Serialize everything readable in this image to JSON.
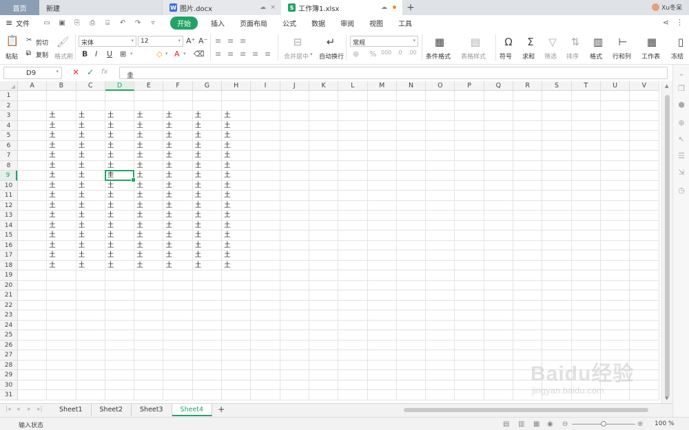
{
  "tabs": {
    "home": "首页",
    "new": "新建",
    "doc": "图片.docx",
    "xlsx": "工作簿1.xlsx",
    "add": "+"
  },
  "user": {
    "name": "Xu冬呆"
  },
  "menu": {
    "file": "文件",
    "items": [
      "开始",
      "插入",
      "页面布局",
      "公式",
      "数据",
      "审阅",
      "视图",
      "工具"
    ]
  },
  "ribbon": {
    "paste": "粘贴",
    "cut": "剪切",
    "copy": "复制",
    "format_painter": "格式刷",
    "font_name": "宋体",
    "font_size": "12",
    "bold": "B",
    "italic": "I",
    "underline": "U",
    "merge": "合并居中",
    "wrap": "自动换行",
    "number_format": "常规",
    "cond_format": "条件格式",
    "table_style": "表格样式",
    "symbol": "符号",
    "sum": "求和",
    "filter": "筛选",
    "sort": "排序",
    "format": "格式",
    "rowcol": "行和列",
    "worksheet": "工作表",
    "freeze": "冻结"
  },
  "formula_bar": {
    "cell_ref": "D9",
    "fx": "fx",
    "content": "圭"
  },
  "grid": {
    "columns": [
      "A",
      "B",
      "C",
      "D",
      "E",
      "F",
      "G",
      "H",
      "I",
      "J",
      "K",
      "L",
      "M",
      "N",
      "O",
      "P",
      "Q",
      "R",
      "S",
      "T",
      "U",
      "V"
    ],
    "rows": 31,
    "active_col": "D",
    "active_row": 9,
    "fill_char": "土",
    "active_char": "圭",
    "filled_rows_from": 3,
    "filled_rows_to": 18,
    "filled_cols": [
      "B",
      "C",
      "D",
      "E",
      "F",
      "G",
      "H"
    ]
  },
  "sheets": [
    "Sheet1",
    "Sheet2",
    "Sheet3",
    "Sheet4"
  ],
  "active_sheet": "Sheet4",
  "status": {
    "text": "输入状态",
    "zoom": "100 %",
    "zoom_level": 0.5
  },
  "watermark": {
    "logo": "Baidu经验",
    "url": "jingyan.baidu.com"
  },
  "colors": {
    "accent": "#21a366",
    "home_tab": "#8b9eb5",
    "docx_icon": "#3b6fd6",
    "xlsx_icon": "#21a366"
  }
}
